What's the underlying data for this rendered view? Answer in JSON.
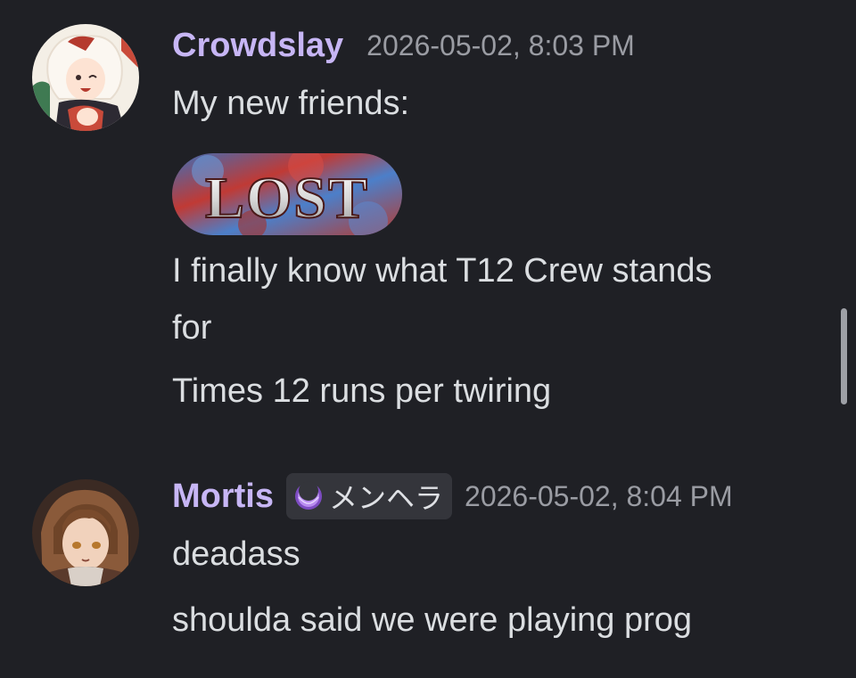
{
  "messages": [
    {
      "username": "Crowdslay",
      "timestamp": "2026-05-02, 8:03 PM",
      "lines": [
        "My new friends:",
        "I finally know what T12 Crew stands",
        "for",
        "Times 12 runs per twiring"
      ],
      "emoji_text": "LOST"
    },
    {
      "username": "Mortis",
      "tag": {
        "icon": "crescent-moon-icon",
        "label": "メンヘラ"
      },
      "timestamp": "2026-05-02, 8:04 PM",
      "lines": [
        "deadass",
        "shoulda said we were playing prog"
      ]
    }
  ],
  "colors": {
    "background": "#1f2025",
    "username": "#c7b6f5",
    "timestamp": "#9a9ca3",
    "text": "#dbdee1",
    "tag_background": "#34353b",
    "tag_icon": "#a874e8"
  }
}
